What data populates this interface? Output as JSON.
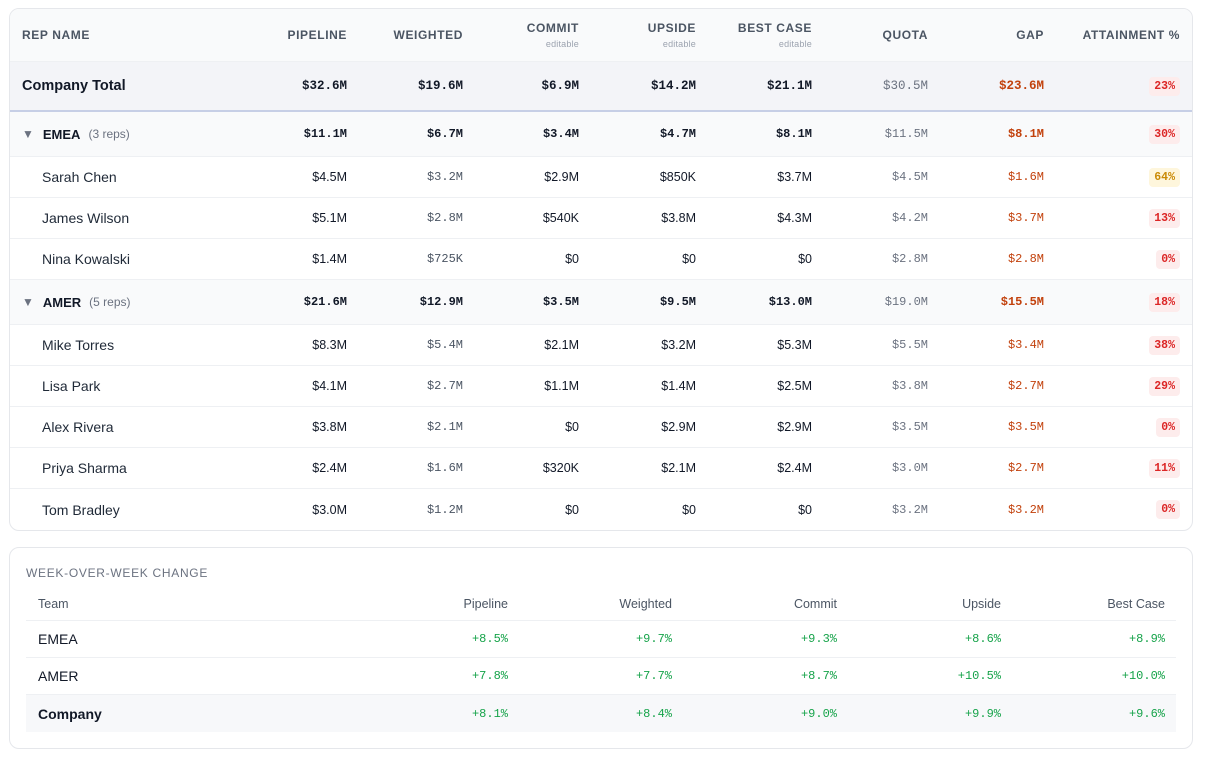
{
  "forecast": {
    "headers": {
      "rep_name": "REP NAME",
      "pipeline": "PIPELINE",
      "weighted": "WEIGHTED",
      "commit": "COMMIT",
      "commit_sub": "editable",
      "upside": "UPSIDE",
      "upside_sub": "editable",
      "best_case": "BEST CASE",
      "best_case_sub": "editable",
      "quota": "QUOTA",
      "gap": "GAP",
      "attainment": "ATTAINMENT %"
    },
    "total": {
      "name": "Company Total",
      "pipeline": "$32.6M",
      "weighted": "$19.6M",
      "commit": "$6.9M",
      "upside": "$14.2M",
      "best_case": "$21.1M",
      "quota": "$30.5M",
      "gap": "$23.6M",
      "attainment": "23%"
    },
    "groups": [
      {
        "name": "EMEA",
        "caret": "▼",
        "reps_label": "(3 reps)",
        "pipeline": "$11.1M",
        "weighted": "$6.7M",
        "commit": "$3.4M",
        "upside": "$4.7M",
        "best_case": "$8.1M",
        "quota": "$11.5M",
        "gap": "$8.1M",
        "attainment": "30%",
        "reps": [
          {
            "name": "Sarah Chen",
            "pipeline": "$4.5M",
            "weighted": "$3.2M",
            "commit": "$2.9M",
            "upside": "$850K",
            "best_case": "$3.7M",
            "quota": "$4.5M",
            "gap": "$1.6M",
            "attainment": "64%",
            "level": "mid"
          },
          {
            "name": "James Wilson",
            "pipeline": "$5.1M",
            "weighted": "$2.8M",
            "commit": "$540K",
            "upside": "$3.8M",
            "best_case": "$4.3M",
            "quota": "$4.2M",
            "gap": "$3.7M",
            "attainment": "13%",
            "level": "low"
          },
          {
            "name": "Nina Kowalski",
            "pipeline": "$1.4M",
            "weighted": "$725K",
            "commit": "$0",
            "upside": "$0",
            "best_case": "$0",
            "quota": "$2.8M",
            "gap": "$2.8M",
            "attainment": "0%",
            "level": "low"
          }
        ]
      },
      {
        "name": "AMER",
        "caret": "▼",
        "reps_label": "(5 reps)",
        "pipeline": "$21.6M",
        "weighted": "$12.9M",
        "commit": "$3.5M",
        "upside": "$9.5M",
        "best_case": "$13.0M",
        "quota": "$19.0M",
        "gap": "$15.5M",
        "attainment": "18%",
        "reps": [
          {
            "name": "Mike Torres",
            "pipeline": "$8.3M",
            "weighted": "$5.4M",
            "commit": "$2.1M",
            "upside": "$3.2M",
            "best_case": "$5.3M",
            "quota": "$5.5M",
            "gap": "$3.4M",
            "attainment": "38%",
            "level": "low"
          },
          {
            "name": "Lisa Park",
            "pipeline": "$4.1M",
            "weighted": "$2.7M",
            "commit": "$1.1M",
            "upside": "$1.4M",
            "best_case": "$2.5M",
            "quota": "$3.8M",
            "gap": "$2.7M",
            "attainment": "29%",
            "level": "low"
          },
          {
            "name": "Alex Rivera",
            "pipeline": "$3.8M",
            "weighted": "$2.1M",
            "commit": "$0",
            "upside": "$2.9M",
            "best_case": "$2.9M",
            "quota": "$3.5M",
            "gap": "$3.5M",
            "attainment": "0%",
            "level": "low"
          },
          {
            "name": "Priya Sharma",
            "pipeline": "$2.4M",
            "weighted": "$1.6M",
            "commit": "$320K",
            "upside": "$2.1M",
            "best_case": "$2.4M",
            "quota": "$3.0M",
            "gap": "$2.7M",
            "attainment": "11%",
            "level": "low"
          },
          {
            "name": "Tom Bradley",
            "pipeline": "$3.0M",
            "weighted": "$1.2M",
            "commit": "$0",
            "upside": "$0",
            "best_case": "$0",
            "quota": "$3.2M",
            "gap": "$3.2M",
            "attainment": "0%",
            "level": "low"
          }
        ]
      }
    ]
  },
  "wow": {
    "title": "WEEK-OVER-WEEK CHANGE",
    "headers": {
      "team": "Team",
      "pipeline": "Pipeline",
      "weighted": "Weighted",
      "commit": "Commit",
      "upside": "Upside",
      "best_case": "Best Case"
    },
    "rows": [
      {
        "team": "EMEA",
        "pipeline": "+8.5%",
        "weighted": "+9.7%",
        "commit": "+9.3%",
        "upside": "+8.6%",
        "best_case": "+8.9%"
      },
      {
        "team": "AMER",
        "pipeline": "+7.8%",
        "weighted": "+7.7%",
        "commit": "+8.7%",
        "upside": "+10.5%",
        "best_case": "+10.0%"
      },
      {
        "team": "Company",
        "pipeline": "+8.1%",
        "weighted": "+8.4%",
        "commit": "+9.0%",
        "upside": "+9.9%",
        "best_case": "+9.6%"
      }
    ]
  },
  "colors": {
    "gap_red": "#c2410c",
    "positive_green": "#16a34a",
    "badge_low_bg": "#fdecec",
    "badge_mid_bg": "#fef6dc"
  }
}
